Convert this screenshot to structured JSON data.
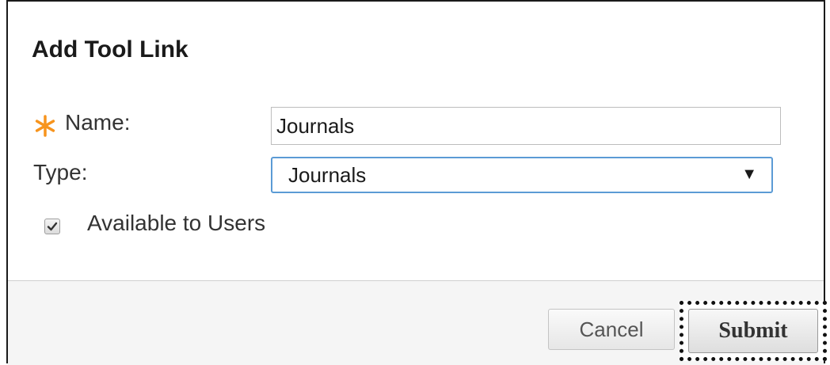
{
  "dialog": {
    "title": "Add Tool Link"
  },
  "form": {
    "name_label": "Name:",
    "name_value": "Journals",
    "required_icon": "asterisk-icon",
    "type_label": "Type:",
    "type_selected": "Journals",
    "type_arrow": "▼",
    "available_label": "Available to Users",
    "available_checked": true
  },
  "footer": {
    "cancel_label": "Cancel",
    "submit_label": "Submit"
  },
  "colors": {
    "required": "#f7941d",
    "select_focus": "#5b9bd5"
  }
}
